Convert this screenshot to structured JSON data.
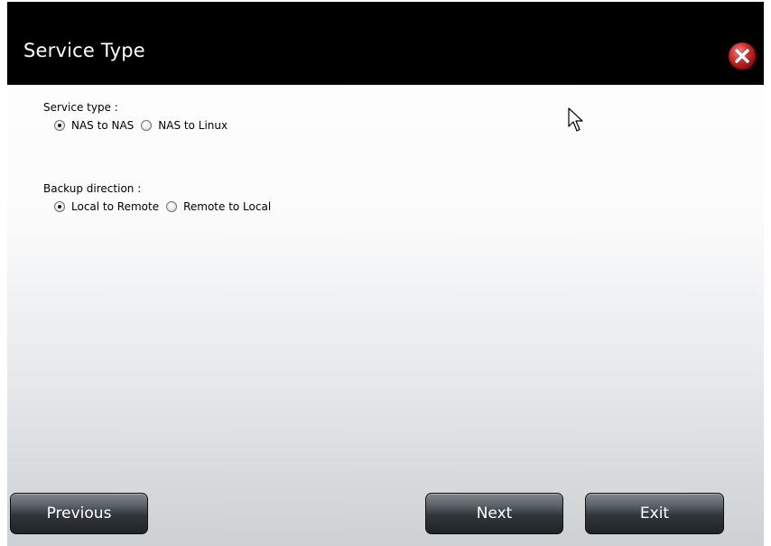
{
  "dialog": {
    "title": "Service Type"
  },
  "service_type": {
    "label": "Service type :",
    "options": [
      {
        "label": "NAS to NAS",
        "checked": true
      },
      {
        "label": "NAS to Linux",
        "checked": false
      }
    ]
  },
  "backup_direction": {
    "label": "Backup direction :",
    "options": [
      {
        "label": "Local to Remote",
        "checked": true
      },
      {
        "label": "Remote to Local",
        "checked": false
      }
    ]
  },
  "buttons": {
    "previous": "Previous",
    "next": "Next",
    "exit": "Exit"
  },
  "colors": {
    "titlebar": "#000000",
    "close_icon": "#cc2222",
    "button_dark": "#2f3539"
  },
  "icons": {
    "close": "close-icon",
    "cursor": "mouse-pointer-icon"
  }
}
